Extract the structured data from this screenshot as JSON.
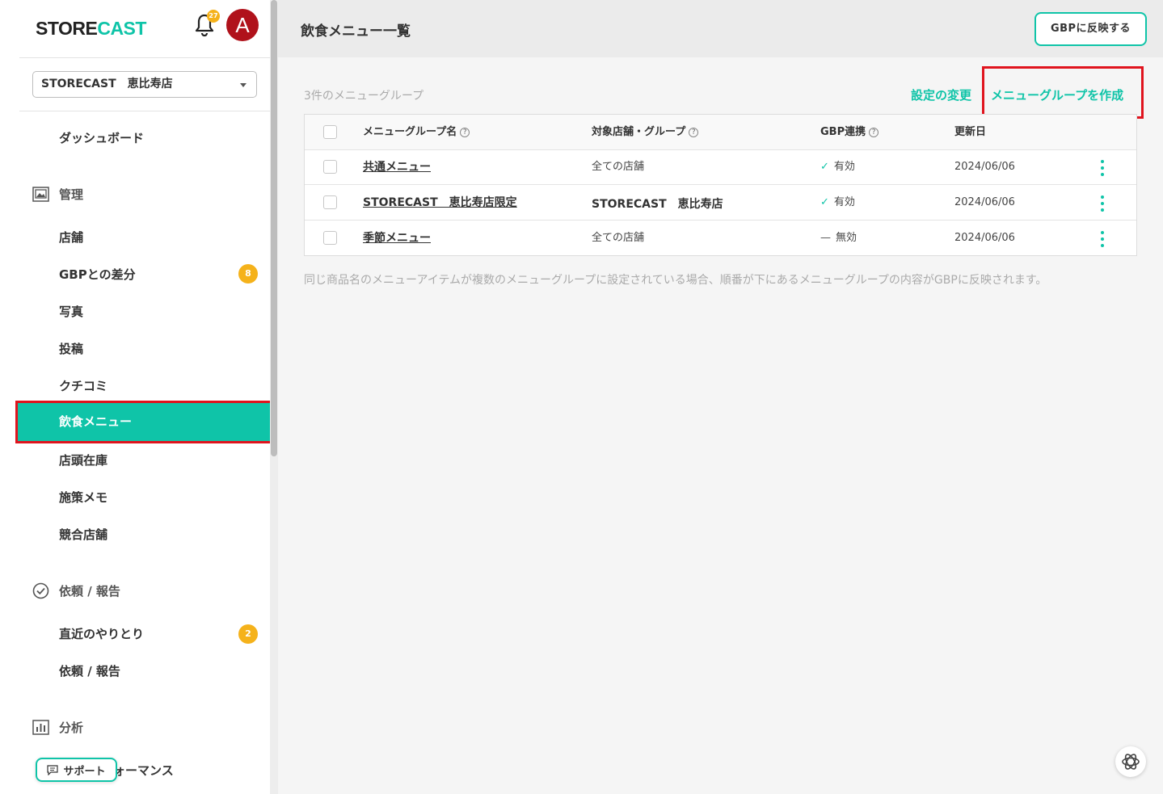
{
  "app": {
    "logo_part1": "STORE",
    "logo_part2": "CAST",
    "notification_count": "27",
    "avatar_letter": "A"
  },
  "sidebar": {
    "store_select": "STORECAST　恵比寿店",
    "dashboard": "ダッシュボード",
    "section_manage": "管理",
    "items_manage": [
      "店舗",
      "GBPとの差分",
      "写真",
      "投稿",
      "クチコミ",
      "飲食メニュー",
      "店頭在庫",
      "施策メモ",
      "競合店舗"
    ],
    "gbp_diff_badge": "8",
    "section_requests": "依頼 / 報告",
    "items_requests": [
      "直近のやりとり",
      "依頼 / 報告"
    ],
    "recent_badge": "2",
    "section_analysis": "分析",
    "performance_partial": "ォーマンス",
    "support_label": "サポート"
  },
  "header": {
    "title": "飲食メニュー一覧",
    "gbp_button": "GBPに反映する"
  },
  "main": {
    "count_label": "3件のメニューグループ",
    "settings_link": "設定の変更",
    "create_link": "メニューグループを作成",
    "columns": [
      "メニューグループ名",
      "対象店舗・グループ",
      "GBP連携",
      "更新日"
    ],
    "rows": [
      {
        "name": "共通メニュー",
        "target": "全ての店舗",
        "gbp": "有効",
        "gbp_on": true,
        "date": "2024/06/06"
      },
      {
        "name": "STORECAST　恵比寿店限定",
        "target": "STORECAST　恵比寿店",
        "gbp": "有効",
        "gbp_on": true,
        "date": "2024/06/06"
      },
      {
        "name": "季節メニュー",
        "target": "全ての店舗",
        "gbp": "無効",
        "gbp_on": false,
        "date": "2024/06/06"
      }
    ],
    "footnote": "同じ商品名のメニューアイテムが複数のメニューグループに設定されている場合、順番が下にあるメニューグループの内容がGBPに反映されます。"
  },
  "colors": {
    "accent": "#0fc4a8",
    "highlight": "#e0141e",
    "badge": "#f5b21b",
    "avatar": "#b0121b"
  }
}
